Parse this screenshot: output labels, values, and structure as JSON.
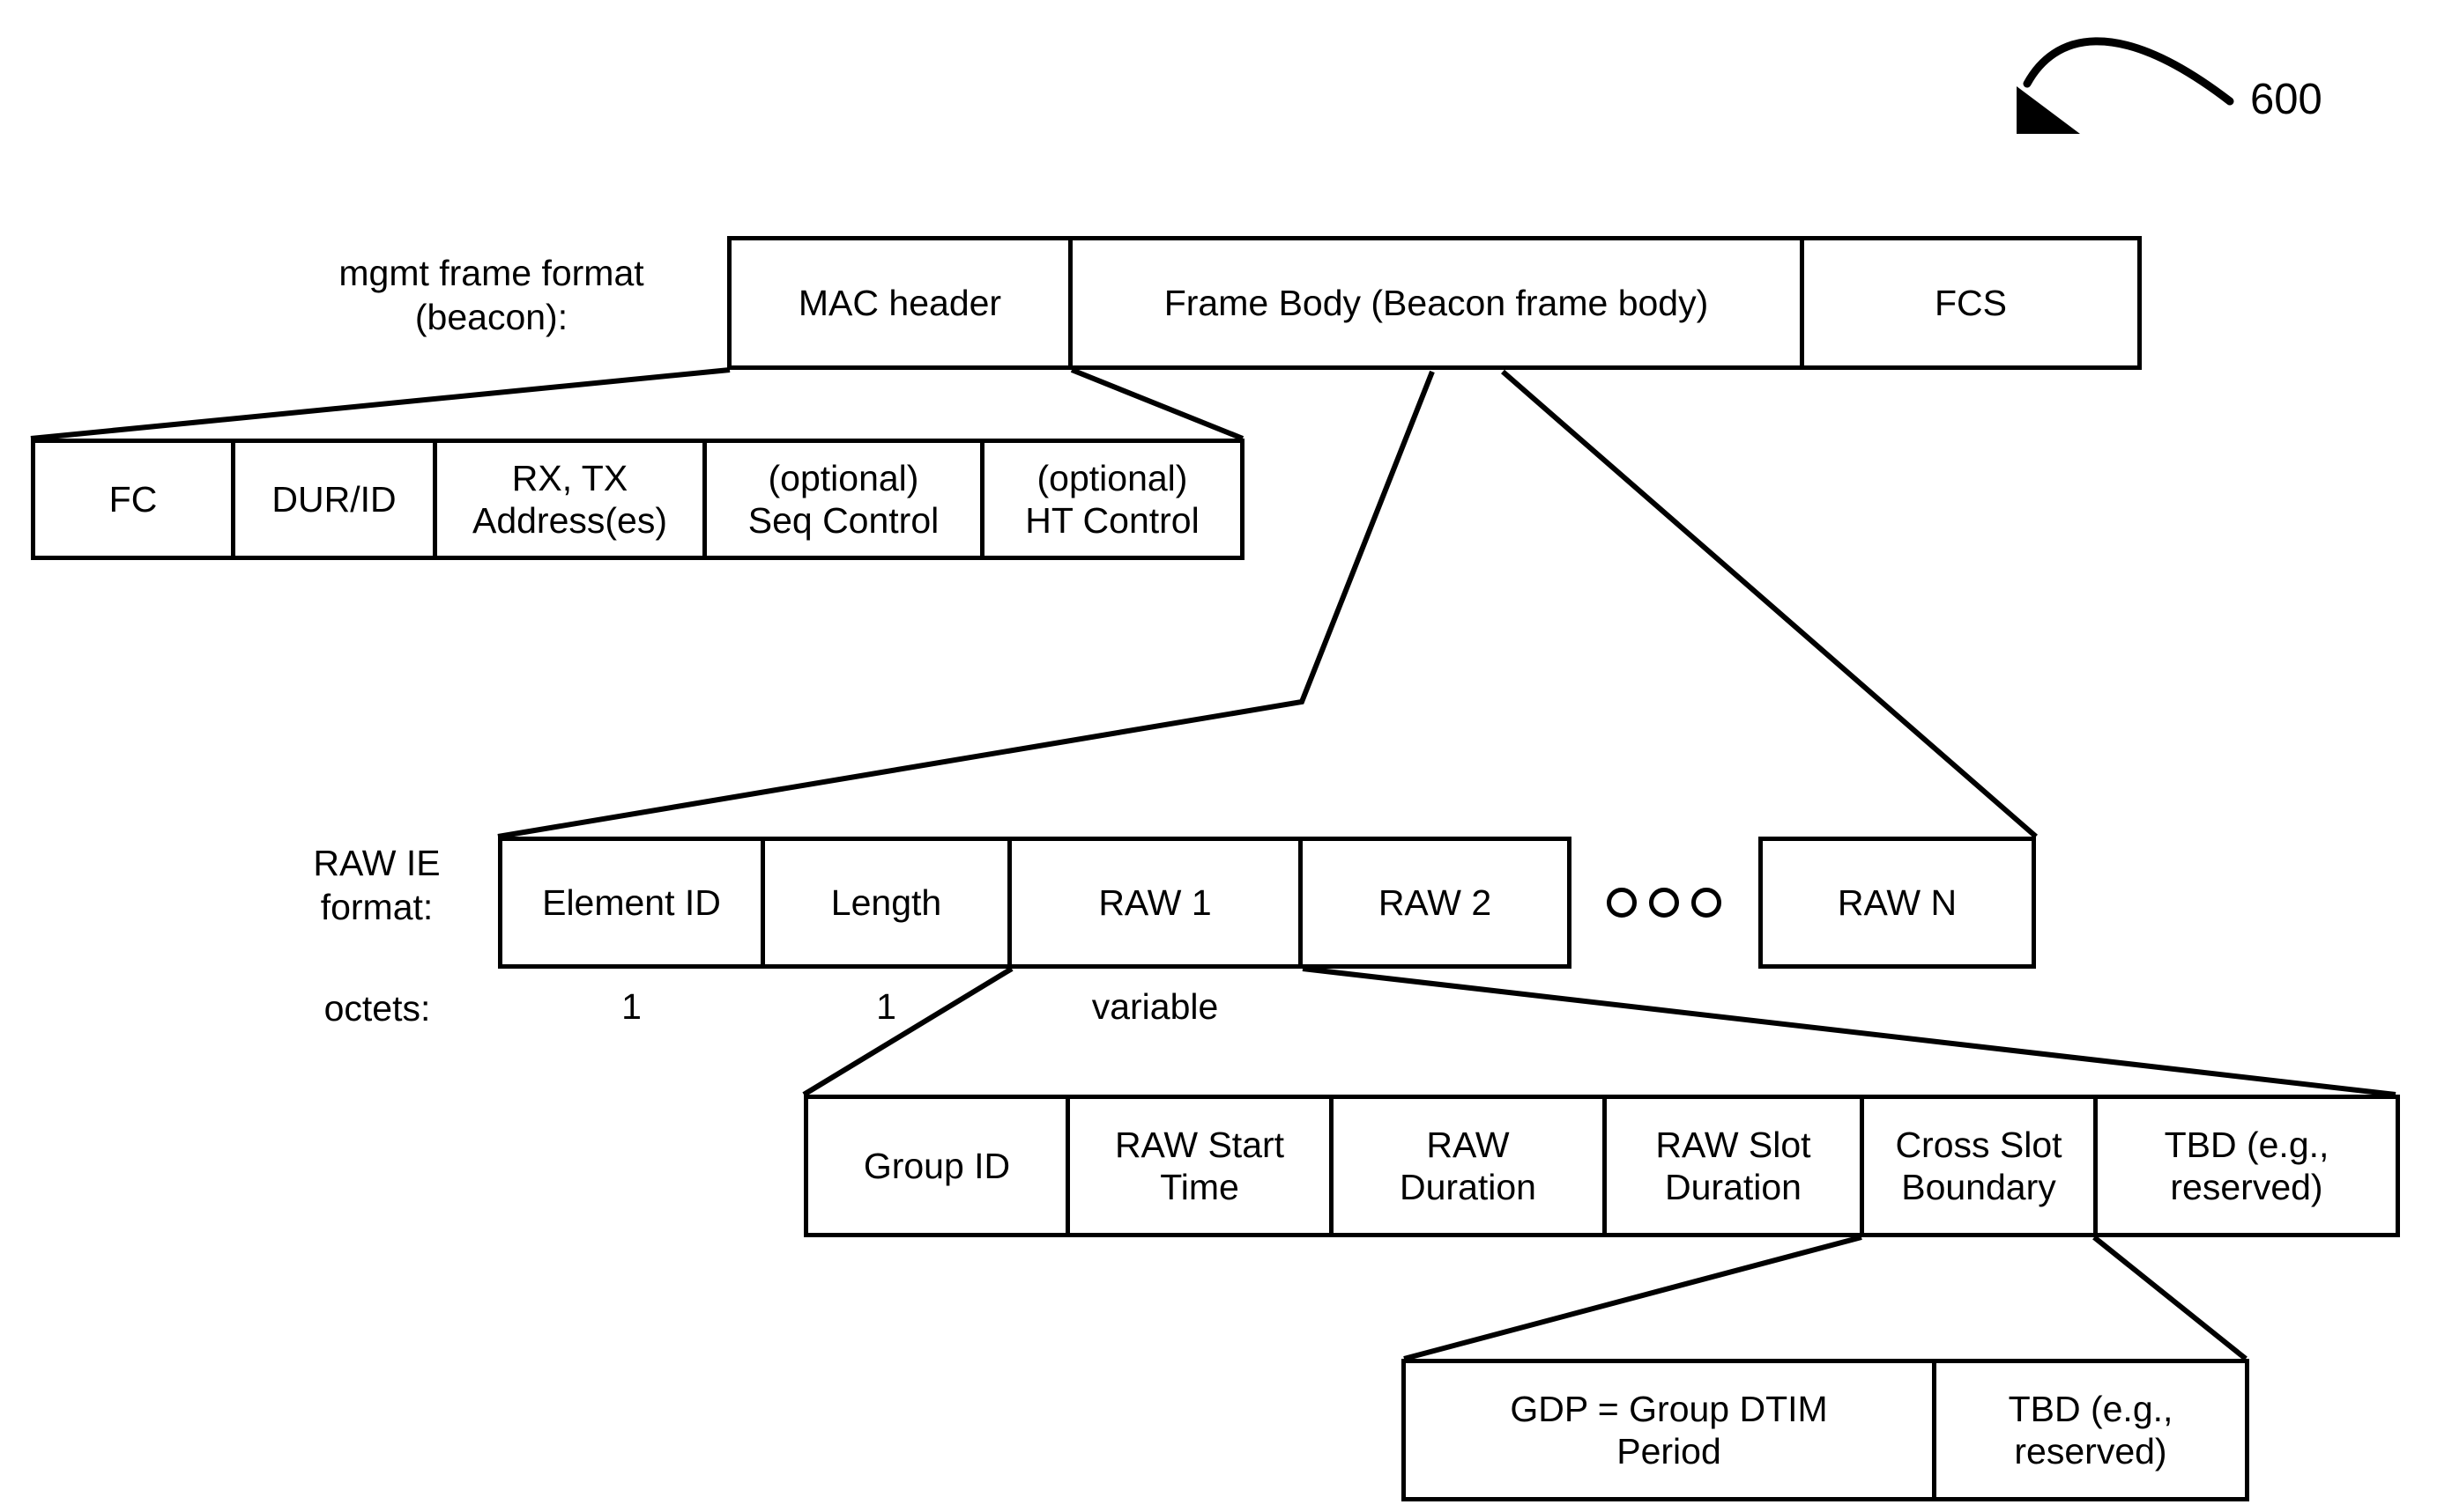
{
  "figure": {
    "reference_number": "600"
  },
  "rows": {
    "mgmt_frame": {
      "label": "mgmt frame format\n(beacon):",
      "fields": [
        {
          "text": "MAC header"
        },
        {
          "text": "Frame Body (Beacon frame body)"
        },
        {
          "text": "FCS"
        }
      ]
    },
    "mac_header": {
      "fields": [
        {
          "text": "FC"
        },
        {
          "text": "DUR/ID"
        },
        {
          "text": "RX, TX\nAddress(es)"
        },
        {
          "text": "(optional)\nSeq Control"
        },
        {
          "text": "(optional)\nHT Control"
        }
      ]
    },
    "raw_ie": {
      "label": "RAW IE\nformat:",
      "octets_label": "octets:",
      "fields": [
        {
          "text": "Element ID",
          "octets": "1"
        },
        {
          "text": "Length",
          "octets": "1"
        },
        {
          "text": "RAW 1",
          "octets": "variable"
        },
        {
          "text": "RAW 2",
          "octets": ""
        }
      ],
      "ellipsis": "ooo",
      "last_field": {
        "text": "RAW N"
      }
    },
    "raw_field": {
      "fields": [
        {
          "text": "Group ID"
        },
        {
          "text": "RAW Start\nTime"
        },
        {
          "text": "RAW\nDuration"
        },
        {
          "text": "RAW Slot\nDuration"
        },
        {
          "text": "Cross Slot\nBoundary"
        },
        {
          "text": "TBD (e.g.,\nreserved)"
        }
      ]
    },
    "cross_slot": {
      "fields": [
        {
          "text": "GDP = Group DTIM\nPeriod"
        },
        {
          "text": "TBD (e.g.,\nreserved)"
        }
      ]
    }
  }
}
